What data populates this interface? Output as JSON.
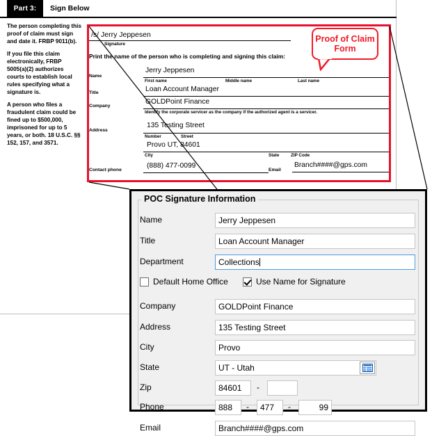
{
  "form": {
    "part_badge": "Part 3:",
    "part_title": "Sign Below",
    "instructions": [
      "The person completing this proof of claim must sign and date it. FRBP 9011(b).",
      "If you file this claim electronically, FRBP 5005(a)(2) authorizes courts to establish local rules specifying what a signature is.",
      "A person who files a fraudulent claim could be fined up to $500,000, imprisoned for up to 5 years, or both. 18 U.S.C. §§ 152, 157, and 3571."
    ],
    "signature_value": "/s/ Jerry Jeppesen",
    "signature_caption": "Signature",
    "print_instruction": "Print the name of the person who is completing and signing this claim:",
    "name_label": "Name",
    "name_value": "Jerry Jeppesen",
    "first_name_caption": "First name",
    "middle_name_caption": "Middle name",
    "last_name_caption": "Last name",
    "title_label": "Title",
    "title_value": "Loan Account Manager",
    "company_label": "Company",
    "company_value": "GOLDPoint Finance",
    "company_note": "Identify the corporate servicer as the company if the authorized agent is a servicer.",
    "address_label": "Address",
    "address_value": "135 Testing Street",
    "number_caption": "Number",
    "street_caption": "Street",
    "city_line_value": "Provo UT, 84601",
    "city_caption": "City",
    "state_caption": "State",
    "zip_caption": "ZIP Code",
    "contact_phone_label": "Contact phone",
    "contact_phone_value": "(888) 477-0099",
    "email_label": "Email",
    "email_value": "Branch####@gps.com"
  },
  "callouts": {
    "proof_of_claim_form": "Proof of Claim Form",
    "field_group": "POC Signature Information field group",
    "color": "#ee1c25"
  },
  "dialog": {
    "group_title": "POC Signature Information",
    "fields": [
      {
        "label": "Name",
        "value": "Jerry Jeppesen"
      },
      {
        "label": "Title",
        "value": "Loan Account Manager"
      },
      {
        "label": "Department",
        "value": "Collections"
      },
      {
        "label": "Company",
        "value": "GOLDPoint Finance"
      },
      {
        "label": "Address",
        "value": "135 Testing Street"
      },
      {
        "label": "City",
        "value": "Provo"
      },
      {
        "label": "State",
        "value": "UT - Utah"
      },
      {
        "label": "Email",
        "value": "Branch####@gps.com"
      }
    ],
    "checkbox_default_home_office": {
      "label": "Default Home Office",
      "checked": false
    },
    "checkbox_use_name_for_signature": {
      "label": "Use Name for Signature",
      "checked": true
    },
    "zip": {
      "label": "Zip",
      "part1": "84601",
      "part2": "",
      "separator": "-"
    },
    "phone": {
      "label": "Phone",
      "part1": "888",
      "part2": "477",
      "part3": "99",
      "separator": "-"
    },
    "state_lookup_icon": "list-lookup-icon",
    "focused_field": "Department",
    "accent_focus_color": "#4a9cdf"
  }
}
